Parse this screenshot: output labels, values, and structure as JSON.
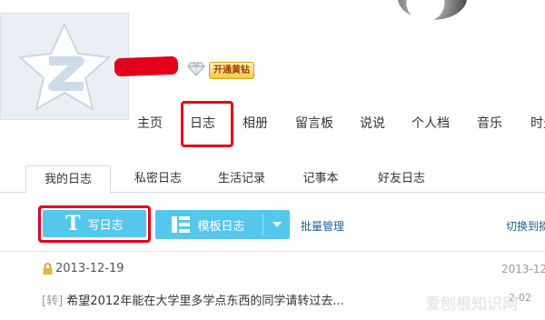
{
  "profile": {
    "vip_label": "开通黄钻"
  },
  "nav": {
    "items": [
      "主页",
      "日志",
      "相册",
      "留言板",
      "说说",
      "个人档",
      "音乐",
      "时光"
    ]
  },
  "tabs": [
    "我的日志",
    "私密日志",
    "生活记录",
    "记事本",
    "好友日志"
  ],
  "toolbar": {
    "write_label": "写日志",
    "write_glyph": "T",
    "template_label": "模板日志",
    "batch_label": "批量管理",
    "switch_label": "切换到摘"
  },
  "list": {
    "date": "2013-12-19",
    "date_right": "2013-12",
    "post_tag": "[转]",
    "post_title": "希望2012年能在大学里多学点东西的同学请转过去...",
    "post_date_right": "2-02"
  },
  "watermark": "爱刨根知识网",
  "colors": {
    "accent_blue": "#56c7ec",
    "annotation_red": "#e3001b",
    "link_blue": "#1f5e9e"
  }
}
